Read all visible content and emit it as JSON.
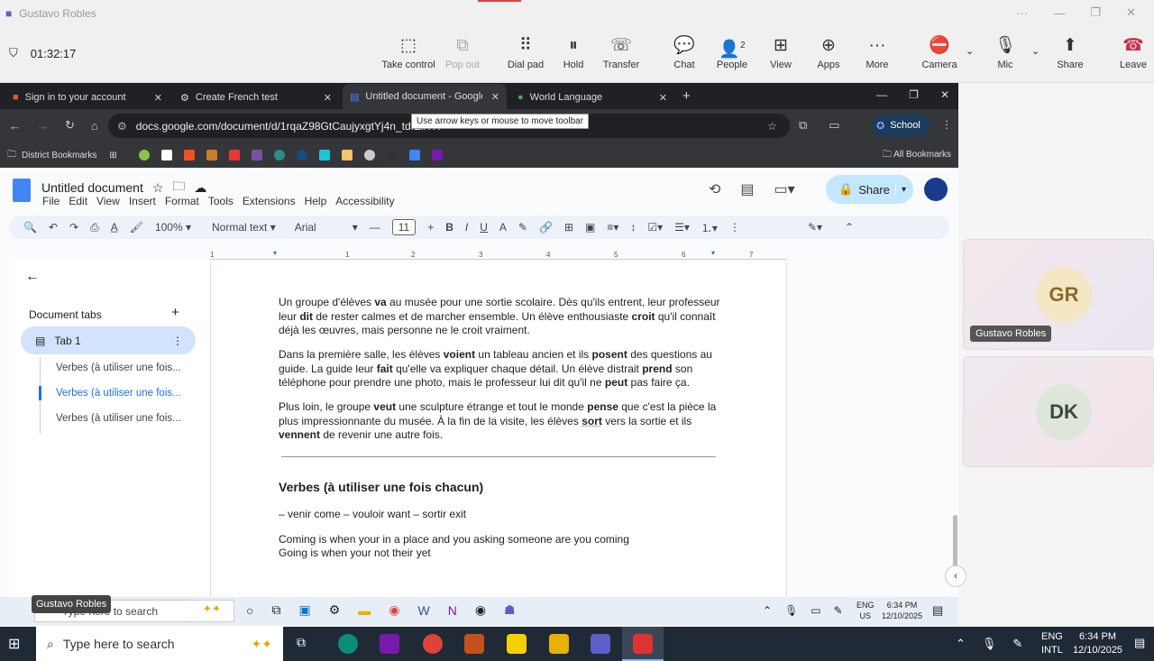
{
  "teams": {
    "window_title": "Gustavo Robles",
    "timer": "01:32:17",
    "buttons": [
      {
        "label": "Take control",
        "icon": "take-control-icon"
      },
      {
        "label": "Pop out",
        "icon": "pop-out-icon"
      },
      {
        "label": "Dial pad",
        "icon": "dial-pad-icon"
      },
      {
        "label": "Hold",
        "icon": "hold-icon"
      },
      {
        "label": "Transfer",
        "icon": "transfer-icon"
      },
      {
        "label": "Chat",
        "icon": "chat-icon"
      },
      {
        "label": "People",
        "icon": "people-icon"
      },
      {
        "label": "View",
        "icon": "view-icon"
      },
      {
        "label": "Apps",
        "icon": "apps-icon"
      },
      {
        "label": "More",
        "icon": "more-icon"
      },
      {
        "label": "Camera",
        "icon": "camera-off-icon"
      },
      {
        "label": "Mic",
        "icon": "mic-icon"
      },
      {
        "label": "Share",
        "icon": "share-icon"
      },
      {
        "label": "Leave",
        "icon": "leave-icon"
      }
    ],
    "people_count": "2",
    "participants": [
      {
        "initials": "GR",
        "name": "Gustavo Robles"
      },
      {
        "initials": "DK"
      }
    ],
    "shared_label": "Gustavo Robles"
  },
  "browser": {
    "tabs": [
      {
        "title": "Sign in to your account"
      },
      {
        "title": "Create French test"
      },
      {
        "title": "Untitled document - Google Docs"
      },
      {
        "title": "World Language"
      }
    ],
    "url": "docs.google.com/document/d/1rqaZ98GtCaujyxgtYj4n_tdfEliYX",
    "tooltip": "Use arrow keys or mouse to move toolbar",
    "profile": "School",
    "bookmarks_folder": "District Bookmarks",
    "all_bookmarks": "All Bookmarks"
  },
  "docs": {
    "title": "Untitled document",
    "menu": [
      "File",
      "Edit",
      "View",
      "Insert",
      "Format",
      "Tools",
      "Extensions",
      "Help",
      "Accessibility"
    ],
    "share": "Share",
    "zoom": "100%",
    "style": "Normal text",
    "font": "Arial",
    "font_size": "11",
    "ruler": [
      "1",
      "1",
      "2",
      "3",
      "4",
      "5",
      "6",
      "7"
    ],
    "sidebar": {
      "heading": "Document tabs",
      "tab": "Tab 1",
      "outline": [
        "Verbes (à utiliser une fois...",
        "Verbes (à utiliser une fois...",
        "Verbes (à utiliser une fois..."
      ]
    },
    "content": {
      "p1": [
        [
          "Un groupe d'élèves ",
          0
        ],
        [
          "va",
          1
        ],
        [
          " au musée pour une sortie scolaire. Dès qu'ils entrent, leur professeur leur ",
          0
        ],
        [
          "dit",
          1
        ],
        [
          " de rester calmes et de marcher ensemble. Un élève enthousiaste ",
          0
        ],
        [
          "croit",
          1
        ],
        [
          " qu'il connaît déjà les œuvres, mais personne ne le croit vraiment.",
          0
        ]
      ],
      "p2": [
        [
          "Dans la première salle, les élèves ",
          0
        ],
        [
          "voient",
          1
        ],
        [
          " un tableau ancien et ils ",
          0
        ],
        [
          "posent",
          1
        ],
        [
          " des questions au guide. La guide leur ",
          0
        ],
        [
          "fait",
          1
        ],
        [
          " qu'elle va expliquer chaque détail. Un élève distrait ",
          0
        ],
        [
          "prend",
          1
        ],
        [
          " son téléphone pour prendre une photo, mais le professeur lui dit qu'il ne ",
          0
        ],
        [
          "peut",
          1
        ],
        [
          " pas faire ça.",
          0
        ]
      ],
      "p3": [
        [
          "Plus loin, le groupe ",
          0
        ],
        [
          "veut",
          1
        ],
        [
          " une sculpture étrange et tout le monde ",
          0
        ],
        [
          "pense",
          1
        ],
        [
          " que c'est la pièce la plus impressionnante du musée. À la fin de la visite, les élèves ",
          0
        ],
        [
          "sort",
          1
        ],
        [
          " vers la sortie et ils ",
          0
        ],
        [
          "vennent",
          1
        ],
        [
          " de revenir une autre fois.",
          0
        ]
      ],
      "heading": "Verbes (à utiliser une fois chacun)",
      "verbs": "– venir come  – vouloir want – sortir exit",
      "line1": "Coming is when your in a place and you asking someone are you coming",
      "line2": "Going is when your not their yet"
    }
  },
  "inner_taskbar": {
    "search": "Type here to search",
    "lang": "ENG",
    "region": "US",
    "time": "6:34 PM",
    "date": "12/10/2025"
  },
  "taskbar": {
    "search": "Type here to search",
    "lang": "ENG",
    "region": "INTL",
    "time": "6:34 PM",
    "date": "12/10/2025"
  }
}
